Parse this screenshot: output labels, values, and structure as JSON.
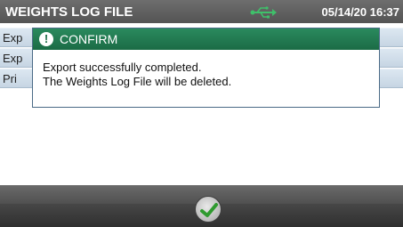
{
  "header": {
    "title": "WEIGHTS LOG FILE",
    "datetime": "05/14/20 16:37",
    "status_icon": "usb-icon"
  },
  "menu": {
    "items": [
      {
        "label": "Exp"
      },
      {
        "label": "Exp"
      },
      {
        "label": "Pri"
      }
    ]
  },
  "dialog": {
    "title": "CONFIRM",
    "icon": "exclamation-icon",
    "line1": "Export successfully completed.",
    "line2": "The Weights Log File will be deleted."
  },
  "footer": {
    "confirm_icon": "checkmark-icon"
  },
  "colors": {
    "dialog_header": "#1b6b45",
    "menu_item": "#c6d5e3",
    "titlebar": "#545454",
    "checkmark": "#2f9a2f"
  }
}
